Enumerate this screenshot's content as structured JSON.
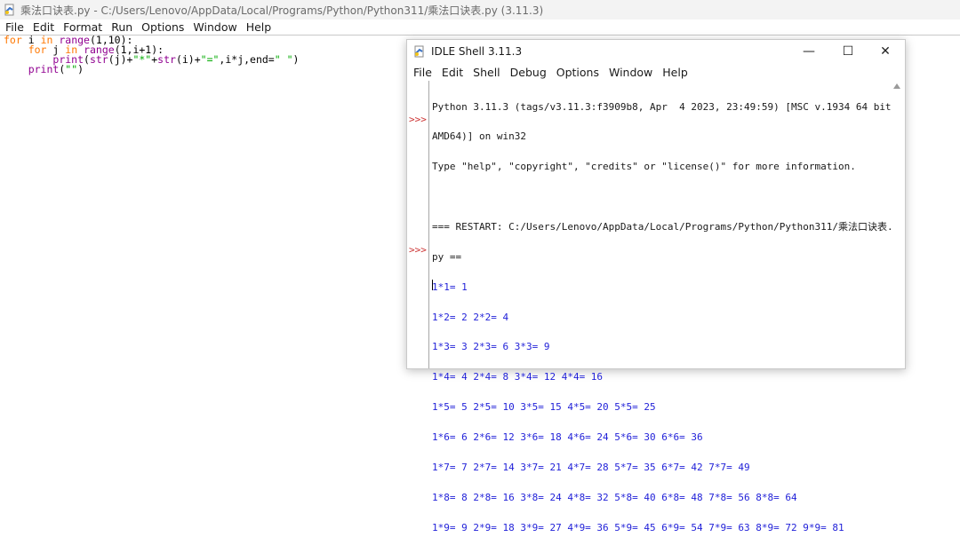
{
  "editor": {
    "title": "乘法口诀表.py - C:/Users/Lenovo/AppData/Local/Programs/Python/Python311/乘法口诀表.py (3.11.3)",
    "menu": [
      "File",
      "Edit",
      "Format",
      "Run",
      "Options",
      "Window",
      "Help"
    ],
    "code": {
      "l1_kw": "for",
      "l1_a": " i ",
      "l1_in": "in",
      "l1_sp": " ",
      "l1_range": "range",
      "l1_b": "(1,10):",
      "l2_ind": "    ",
      "l2_kw": "for",
      "l2_a": " j ",
      "l2_in": "in",
      "l2_sp": " ",
      "l2_range": "range",
      "l2_b": "(1,i+1):",
      "l3_ind": "        ",
      "l3_print": "print",
      "l3_a": "(",
      "l3_str1": "str",
      "l3_b": "(j)+",
      "l3_s1": "\"*\"",
      "l3_c": "+",
      "l3_str2": "str",
      "l3_d": "(i)+",
      "l3_s2": "\"=\"",
      "l3_e": ",i*j,end=",
      "l3_s3": "\" \"",
      "l3_f": ")",
      "l4_ind": "    ",
      "l4_print": "print",
      "l4_a": "(",
      "l4_s": "\"\"",
      "l4_b": ")"
    }
  },
  "shell": {
    "title": "IDLE Shell 3.11.3",
    "controls": {
      "minimize": "—",
      "maximize": "☐",
      "close": "✕"
    },
    "menu": [
      "File",
      "Edit",
      "Shell",
      "Debug",
      "Options",
      "Window",
      "Help"
    ],
    "prompt": ">>>",
    "banner": [
      "Python 3.11.3 (tags/v3.11.3:f3909b8, Apr  4 2023, 23:49:59) [MSC v.1934 64 bit (",
      "AMD64)] on win32",
      "Type \"help\", \"copyright\", \"credits\" or \"license()\" for more information."
    ],
    "restart": [
      "=== RESTART: C:/Users/Lenovo/AppData/Local/Programs/Python/Python311/乘法口诀表.",
      "py =="
    ],
    "output": [
      "1*1= 1",
      "1*2= 2 2*2= 4",
      "1*3= 3 2*3= 6 3*3= 9",
      "1*4= 4 2*4= 8 3*4= 12 4*4= 16",
      "1*5= 5 2*5= 10 3*5= 15 4*5= 20 5*5= 25",
      "1*6= 6 2*6= 12 3*6= 18 4*6= 24 5*6= 30 6*6= 36",
      "1*7= 7 2*7= 14 3*7= 21 4*7= 28 5*7= 35 6*7= 42 7*7= 49",
      "1*8= 8 2*8= 16 3*8= 24 4*8= 32 5*8= 40 6*8= 48 7*8= 56 8*8= 64",
      "1*9= 9 2*9= 18 3*9= 27 4*9= 36 5*9= 45 6*9= 54 7*9= 63 8*9= 72 9*9= 81"
    ]
  }
}
